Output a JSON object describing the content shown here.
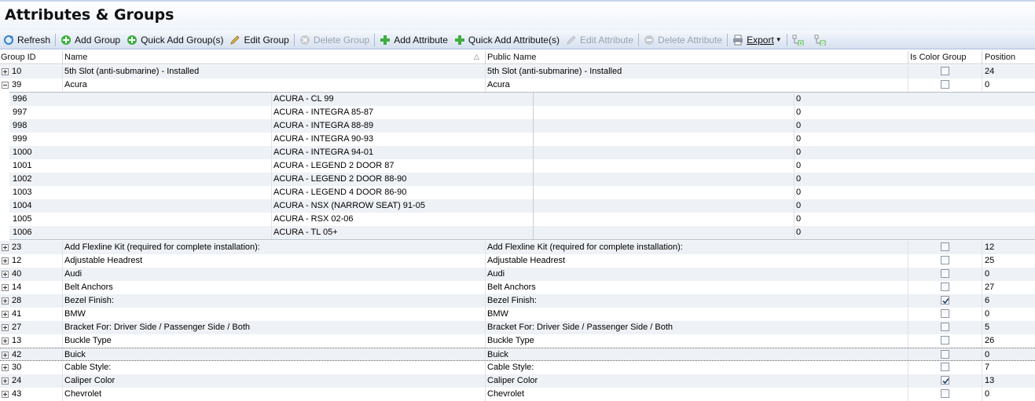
{
  "title": "Attributes & Groups",
  "toolbar": {
    "refresh": "Refresh",
    "add_group": "Add Group",
    "quick_add_group": "Quick Add Group(s)",
    "edit_group": "Edit Group",
    "delete_group": "Delete Group",
    "add_attribute": "Add Attribute",
    "quick_add_attribute": "Quick Add Attribute(s)",
    "edit_attribute": "Edit Attribute",
    "delete_attribute": "Delete Attribute",
    "export": "Export"
  },
  "columns": {
    "group_id": "Group ID",
    "name": "Name",
    "public_name": "Public Name",
    "is_color_group": "Is Color Group",
    "position": "Position"
  },
  "top_rows": [
    {
      "id": "10",
      "name": "5th Slot (anti-submarine) - Installed",
      "public": "5th Slot (anti-submarine) - Installed",
      "color": false,
      "position": "24",
      "expanded": false
    },
    {
      "id": "39",
      "name": "Acura",
      "public": "Acura",
      "color": false,
      "position": "0",
      "expanded": true
    }
  ],
  "children": [
    {
      "id": "996",
      "name": "ACURA - CL 99",
      "value": "0"
    },
    {
      "id": "997",
      "name": "ACURA - INTEGRA 85-87",
      "value": "0"
    },
    {
      "id": "998",
      "name": "ACURA - INTEGRA 88-89",
      "value": "0"
    },
    {
      "id": "999",
      "name": "ACURA - INTEGRA 90-93",
      "value": "0"
    },
    {
      "id": "1000",
      "name": "ACURA - INTEGRA 94-01",
      "value": "0"
    },
    {
      "id": "1001",
      "name": "ACURA - LEGEND 2 DOOR 87",
      "value": "0"
    },
    {
      "id": "1002",
      "name": "ACURA - LEGEND 2 DOOR 88-90",
      "value": "0"
    },
    {
      "id": "1003",
      "name": "ACURA - LEGEND 4 DOOR 86-90",
      "value": "0"
    },
    {
      "id": "1004",
      "name": "ACURA - NSX (NARROW SEAT) 91-05",
      "value": "0"
    },
    {
      "id": "1005",
      "name": "ACURA - RSX 02-06",
      "value": "0"
    },
    {
      "id": "1006",
      "name": "ACURA - TL 05+",
      "value": "0"
    }
  ],
  "rows": [
    {
      "id": "23",
      "name": "Add Flexline Kit (required for complete installation):",
      "public": "Add Flexline Kit (required for complete installation):",
      "color": false,
      "position": "12"
    },
    {
      "id": "12",
      "name": "Adjustable Headrest",
      "public": "Adjustable Headrest",
      "color": false,
      "position": "25"
    },
    {
      "id": "40",
      "name": "Audi",
      "public": "Audi",
      "color": false,
      "position": "0"
    },
    {
      "id": "14",
      "name": "Belt Anchors",
      "public": "Belt Anchors",
      "color": false,
      "position": "27"
    },
    {
      "id": "28",
      "name": "Bezel Finish:",
      "public": "Bezel Finish:",
      "color": true,
      "position": "6"
    },
    {
      "id": "41",
      "name": "BMW",
      "public": "BMW",
      "color": false,
      "position": "0"
    },
    {
      "id": "27",
      "name": "Bracket For:  Driver Side /  Passenger Side / Both",
      "public": "Bracket For:  Driver Side / Passenger Side / Both",
      "color": false,
      "position": "5"
    },
    {
      "id": "13",
      "name": "Buckle Type",
      "public": "Buckle Type",
      "color": false,
      "position": "26"
    },
    {
      "id": "42",
      "name": "Buick",
      "public": "Buick",
      "color": false,
      "position": "0",
      "focused": true
    },
    {
      "id": "30",
      "name": "Cable Style:",
      "public": "Cable Style:",
      "color": false,
      "position": "7"
    },
    {
      "id": "24",
      "name": "Caliper Color",
      "public": "Caliper Color",
      "color": true,
      "position": "13"
    },
    {
      "id": "43",
      "name": "Chevrolet",
      "public": "Chevrolet",
      "color": false,
      "position": "0"
    }
  ]
}
